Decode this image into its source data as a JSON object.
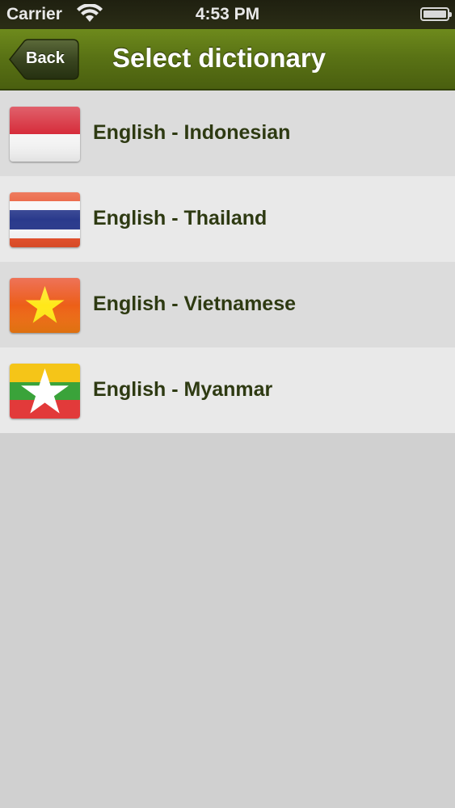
{
  "status_bar": {
    "carrier": "Carrier",
    "time": "4:53 PM"
  },
  "nav_bar": {
    "back_label": "Back",
    "title": "Select dictionary"
  },
  "dictionaries": [
    {
      "label": "English - Indonesian",
      "flag": "indonesia-flag-icon"
    },
    {
      "label": "English - Thailand",
      "flag": "thailand-flag-icon"
    },
    {
      "label": "English - Vietnamese",
      "flag": "vietnam-flag-icon"
    },
    {
      "label": "English - Myanmar",
      "flag": "myanmar-flag-icon"
    }
  ],
  "colors": {
    "nav_green": "#5a7315",
    "row_text": "#2e3a12",
    "background": "#d0d0d0"
  }
}
